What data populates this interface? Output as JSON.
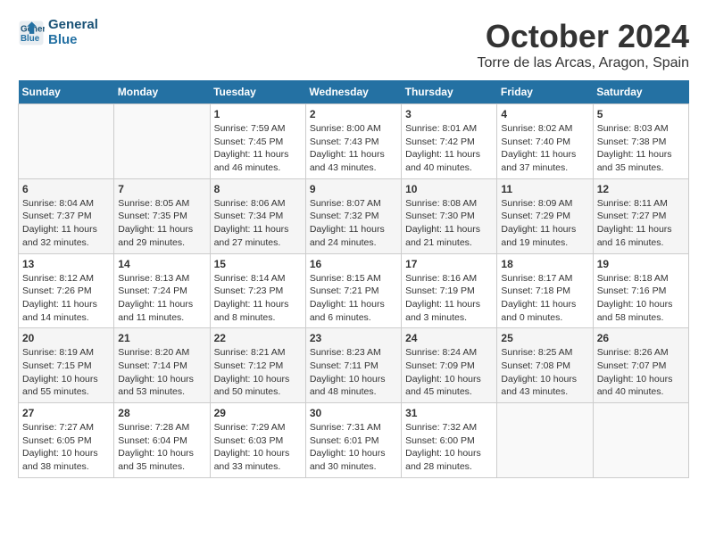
{
  "header": {
    "logo_line1": "General",
    "logo_line2": "Blue",
    "month": "October 2024",
    "location": "Torre de las Arcas, Aragon, Spain"
  },
  "days_of_week": [
    "Sunday",
    "Monday",
    "Tuesday",
    "Wednesday",
    "Thursday",
    "Friday",
    "Saturday"
  ],
  "weeks": [
    [
      {
        "day": "",
        "info": ""
      },
      {
        "day": "",
        "info": ""
      },
      {
        "day": "1",
        "info": "Sunrise: 7:59 AM\nSunset: 7:45 PM\nDaylight: 11 hours and 46 minutes."
      },
      {
        "day": "2",
        "info": "Sunrise: 8:00 AM\nSunset: 7:43 PM\nDaylight: 11 hours and 43 minutes."
      },
      {
        "day": "3",
        "info": "Sunrise: 8:01 AM\nSunset: 7:42 PM\nDaylight: 11 hours and 40 minutes."
      },
      {
        "day": "4",
        "info": "Sunrise: 8:02 AM\nSunset: 7:40 PM\nDaylight: 11 hours and 37 minutes."
      },
      {
        "day": "5",
        "info": "Sunrise: 8:03 AM\nSunset: 7:38 PM\nDaylight: 11 hours and 35 minutes."
      }
    ],
    [
      {
        "day": "6",
        "info": "Sunrise: 8:04 AM\nSunset: 7:37 PM\nDaylight: 11 hours and 32 minutes."
      },
      {
        "day": "7",
        "info": "Sunrise: 8:05 AM\nSunset: 7:35 PM\nDaylight: 11 hours and 29 minutes."
      },
      {
        "day": "8",
        "info": "Sunrise: 8:06 AM\nSunset: 7:34 PM\nDaylight: 11 hours and 27 minutes."
      },
      {
        "day": "9",
        "info": "Sunrise: 8:07 AM\nSunset: 7:32 PM\nDaylight: 11 hours and 24 minutes."
      },
      {
        "day": "10",
        "info": "Sunrise: 8:08 AM\nSunset: 7:30 PM\nDaylight: 11 hours and 21 minutes."
      },
      {
        "day": "11",
        "info": "Sunrise: 8:09 AM\nSunset: 7:29 PM\nDaylight: 11 hours and 19 minutes."
      },
      {
        "day": "12",
        "info": "Sunrise: 8:11 AM\nSunset: 7:27 PM\nDaylight: 11 hours and 16 minutes."
      }
    ],
    [
      {
        "day": "13",
        "info": "Sunrise: 8:12 AM\nSunset: 7:26 PM\nDaylight: 11 hours and 14 minutes."
      },
      {
        "day": "14",
        "info": "Sunrise: 8:13 AM\nSunset: 7:24 PM\nDaylight: 11 hours and 11 minutes."
      },
      {
        "day": "15",
        "info": "Sunrise: 8:14 AM\nSunset: 7:23 PM\nDaylight: 11 hours and 8 minutes."
      },
      {
        "day": "16",
        "info": "Sunrise: 8:15 AM\nSunset: 7:21 PM\nDaylight: 11 hours and 6 minutes."
      },
      {
        "day": "17",
        "info": "Sunrise: 8:16 AM\nSunset: 7:19 PM\nDaylight: 11 hours and 3 minutes."
      },
      {
        "day": "18",
        "info": "Sunrise: 8:17 AM\nSunset: 7:18 PM\nDaylight: 11 hours and 0 minutes."
      },
      {
        "day": "19",
        "info": "Sunrise: 8:18 AM\nSunset: 7:16 PM\nDaylight: 10 hours and 58 minutes."
      }
    ],
    [
      {
        "day": "20",
        "info": "Sunrise: 8:19 AM\nSunset: 7:15 PM\nDaylight: 10 hours and 55 minutes."
      },
      {
        "day": "21",
        "info": "Sunrise: 8:20 AM\nSunset: 7:14 PM\nDaylight: 10 hours and 53 minutes."
      },
      {
        "day": "22",
        "info": "Sunrise: 8:21 AM\nSunset: 7:12 PM\nDaylight: 10 hours and 50 minutes."
      },
      {
        "day": "23",
        "info": "Sunrise: 8:23 AM\nSunset: 7:11 PM\nDaylight: 10 hours and 48 minutes."
      },
      {
        "day": "24",
        "info": "Sunrise: 8:24 AM\nSunset: 7:09 PM\nDaylight: 10 hours and 45 minutes."
      },
      {
        "day": "25",
        "info": "Sunrise: 8:25 AM\nSunset: 7:08 PM\nDaylight: 10 hours and 43 minutes."
      },
      {
        "day": "26",
        "info": "Sunrise: 8:26 AM\nSunset: 7:07 PM\nDaylight: 10 hours and 40 minutes."
      }
    ],
    [
      {
        "day": "27",
        "info": "Sunrise: 7:27 AM\nSunset: 6:05 PM\nDaylight: 10 hours and 38 minutes."
      },
      {
        "day": "28",
        "info": "Sunrise: 7:28 AM\nSunset: 6:04 PM\nDaylight: 10 hours and 35 minutes."
      },
      {
        "day": "29",
        "info": "Sunrise: 7:29 AM\nSunset: 6:03 PM\nDaylight: 10 hours and 33 minutes."
      },
      {
        "day": "30",
        "info": "Sunrise: 7:31 AM\nSunset: 6:01 PM\nDaylight: 10 hours and 30 minutes."
      },
      {
        "day": "31",
        "info": "Sunrise: 7:32 AM\nSunset: 6:00 PM\nDaylight: 10 hours and 28 minutes."
      },
      {
        "day": "",
        "info": ""
      },
      {
        "day": "",
        "info": ""
      }
    ]
  ]
}
